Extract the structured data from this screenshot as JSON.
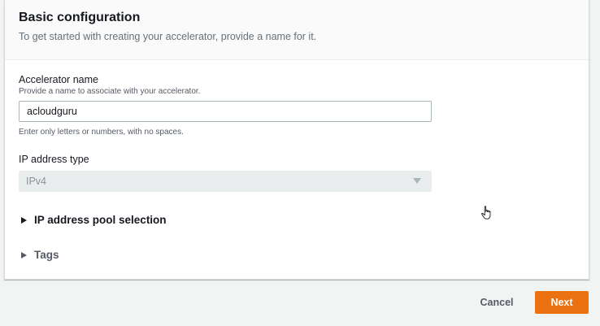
{
  "section": {
    "title": "Basic configuration",
    "description": "To get started with creating your accelerator, provide a name for it."
  },
  "accelerator_name": {
    "label": "Accelerator name",
    "description": "Provide a name to associate with your accelerator.",
    "value": "acloudguru",
    "constraint": "Enter only letters or numbers, with no spaces."
  },
  "ip_address_type": {
    "label": "IP address type",
    "selected": "IPv4"
  },
  "expanders": {
    "pool_selection": "IP address pool selection",
    "tags": "Tags"
  },
  "footer": {
    "cancel_label": "Cancel",
    "next_label": "Next"
  },
  "colors": {
    "primary": "#ec7211",
    "background": "#f2f3f3"
  }
}
